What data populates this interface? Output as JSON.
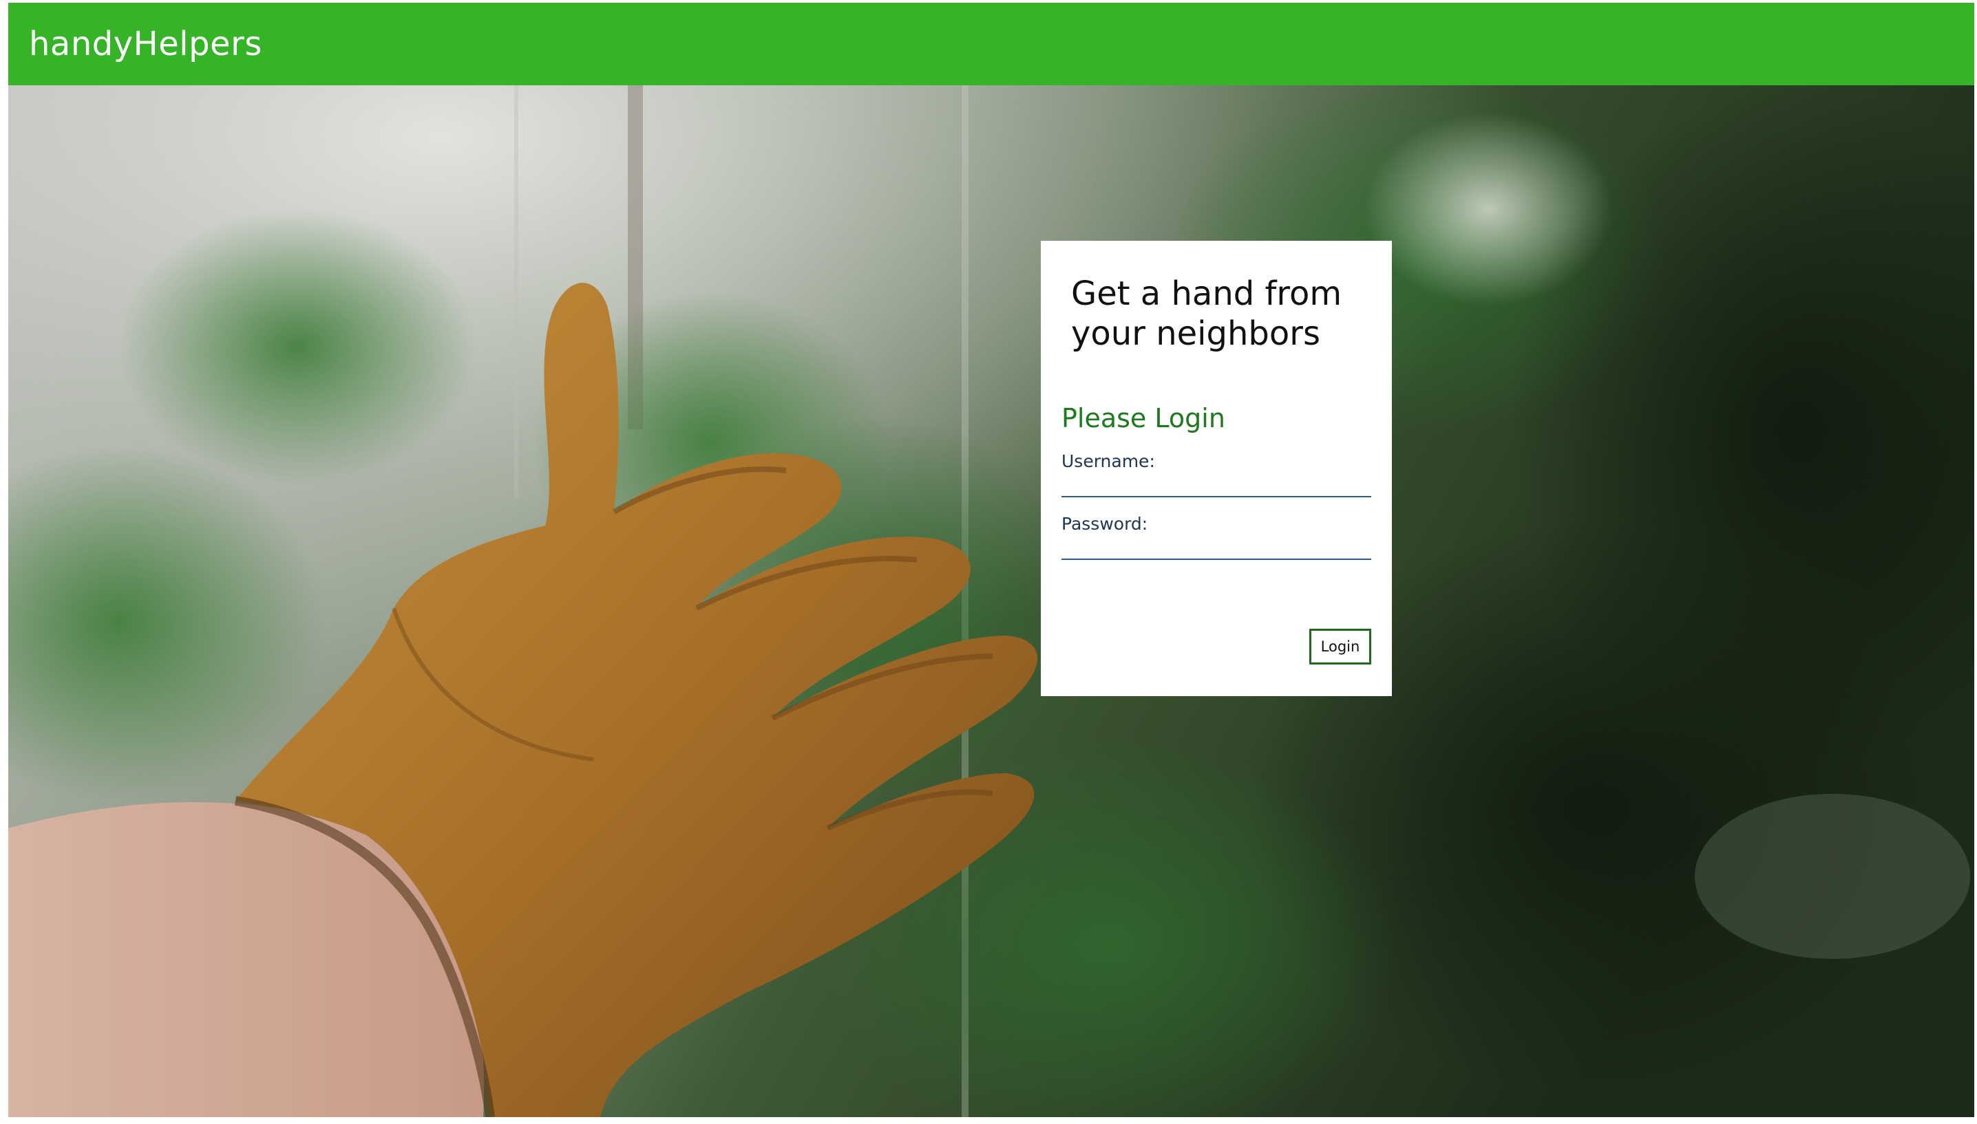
{
  "colors": {
    "brand": "#35b427",
    "accent": "#1e7a1e",
    "input_underline": "#2f5b8c"
  },
  "navbar": {
    "brand": "handyHelpers"
  },
  "hero": {
    "image": "gloved-hand-reaching-into-forest"
  },
  "login": {
    "tagline": "Get a hand from your neighbors",
    "title": "Please Login",
    "username_label": "Username:",
    "username_value": "",
    "password_label": "Password:",
    "password_value": "",
    "submit_label": "Login"
  }
}
